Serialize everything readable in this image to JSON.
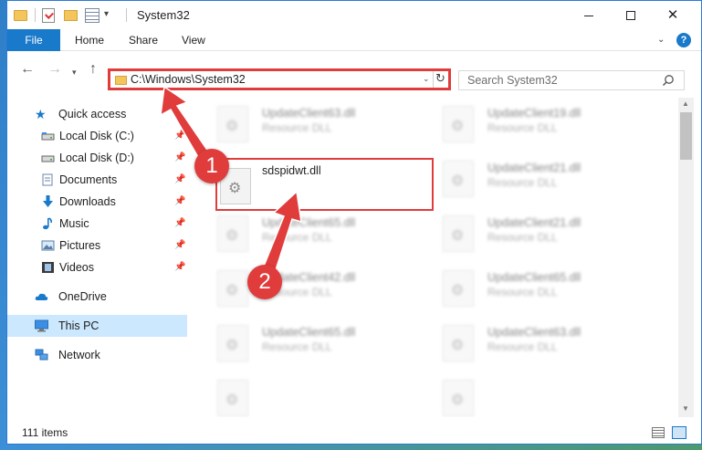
{
  "window": {
    "title": "System32",
    "controls": {
      "minimize": "minimize-icon",
      "maximize": "maximize-icon",
      "close": "✕"
    }
  },
  "ribbon": {
    "tabs": [
      "File",
      "Home",
      "Share",
      "View"
    ]
  },
  "address_bar": {
    "path": "C:\\Windows\\System32"
  },
  "search": {
    "placeholder": "Search System32"
  },
  "sidebar": {
    "items": [
      {
        "label": "Quick access",
        "icon": "star-icon",
        "pinned": false,
        "selected": false
      },
      {
        "label": "Local Disk (C:)",
        "icon": "drive-icon",
        "pinned": true,
        "selected": false
      },
      {
        "label": "Local Disk (D:)",
        "icon": "drive-icon",
        "pinned": true,
        "selected": false
      },
      {
        "label": "Documents",
        "icon": "documents-icon",
        "pinned": true,
        "selected": false
      },
      {
        "label": "Downloads",
        "icon": "download-icon",
        "pinned": true,
        "selected": false
      },
      {
        "label": "Music",
        "icon": "music-icon",
        "pinned": true,
        "selected": false
      },
      {
        "label": "Pictures",
        "icon": "pictures-icon",
        "pinned": true,
        "selected": false
      },
      {
        "label": "Videos",
        "icon": "videos-icon",
        "pinned": true,
        "selected": false
      },
      {
        "label": "OneDrive",
        "icon": "cloud-icon",
        "pinned": false,
        "selected": false
      },
      {
        "label": "This PC",
        "icon": "computer-icon",
        "pinned": false,
        "selected": true
      },
      {
        "label": "Network",
        "icon": "network-icon",
        "pinned": false,
        "selected": false
      }
    ]
  },
  "files": [
    {
      "name": "UpdateClient63.dll",
      "type": "Resource DLL"
    },
    {
      "name": "UpdateClient19.dll",
      "type": "Resource DLL"
    },
    {
      "name": "sdspidwt.dll",
      "type": ""
    },
    {
      "name": "UpdateClient21.dll",
      "type": "Resource DLL"
    },
    {
      "name": "UpdateClient65.dll",
      "type": "Resource DLL"
    },
    {
      "name": "UpdateClient21.dll",
      "type": "Resource DLL"
    },
    {
      "name": "UpdateClient42.dll",
      "type": "Resource DLL"
    },
    {
      "name": "UpdateClient65.dll",
      "type": "Resource DLL"
    },
    {
      "name": "UpdateClient65.dll",
      "type": "Resource DLL"
    },
    {
      "name": "UpdateClient63.dll",
      "type": "Resource DLL"
    }
  ],
  "status": {
    "item_count": "111 items"
  },
  "annotations": {
    "step1": "1",
    "step2": "2",
    "color": "#e03c3c"
  }
}
